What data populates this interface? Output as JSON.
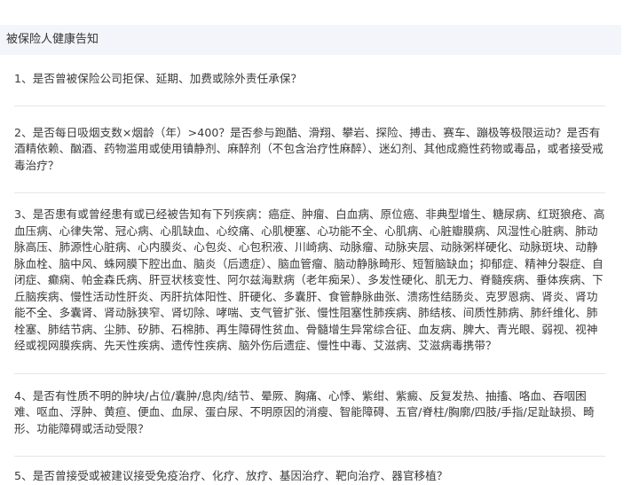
{
  "header": {
    "title": "被保险人健康告知"
  },
  "questions": [
    {
      "text": "1、是否曾被保险公司拒保、延期、加费或除外责任承保？"
    },
    {
      "text": "2、是否每日吸烟支数×烟龄（年）>400？是否参与跑酷、滑翔、攀岩、探险、搏击、赛车、蹦极等极限运动？是否有酒精依赖、酗酒、药物滥用或使用镇静剂、麻醉剂（不包含治疗性麻醉）、迷幻剂、其他成瘾性药物或毒品，或者接受戒毒治疗？"
    },
    {
      "text": "3、是否患有或曾经患有或已经被告知有下列疾病：癌症、肿瘤、白血病、原位癌、非典型增生、糖尿病、红斑狼疮、高血压病、心律失常、冠心病、心肌缺血、心绞痛、心肌梗塞、心功能不全、心肌病、心脏瓣膜病、风湿性心脏病、肺动脉高压、肺源性心脏病、心内膜炎、心包炎、心包积液、川崎病、动脉瘤、动脉夹层、动脉粥样硬化、动脉斑块、动静脉血栓、脑中风、蛛网膜下腔出血、脑炎（后遗症）、脑血管瘤、脑动静脉畸形、短暂脑缺血；抑郁症、精神分裂症、自闭症、癫痫、帕金森氏病、肝豆状核变性、阿尔兹海默病（老年痴呆）、多发性硬化、肌无力、脊髓疾病、垂体疾病、下丘脑疾病、慢性活动性肝炎、丙肝抗体阳性、肝硬化、多囊肝、食管静脉曲张、溃疡性结肠炎、克罗恩病、肾炎、肾功能不全、多囊肾、肾动脉狭窄、肾切除、哮喘、支气管扩张、慢性阻塞性肺疾病、肺结核、间质性肺病、肺纤维化、肺栓塞、肺结节病、尘肺、矽肺、石棉肺、再生障碍性贫血、骨髓增生异常综合征、血友病、脾大、青光眼、弱视、视神经或视网膜疾病、先天性疾病、遗传性疾病、脑外伤后遗症、慢性中毒、艾滋病、艾滋病毒携带？"
    },
    {
      "text": "4、是否有性质不明的肿块/占位/囊肿/息肉/结节、晕厥、胸痛、心悸、紫绀、紫癜、反复发热、抽搐、咯血、吞咽困难、呕血、浮肿、黄疸、便血、血尿、蛋白尿、不明原因的消瘦、智能障碍、五官/脊柱/胸廓/四肢/手指/足趾缺损、畸形、功能障碍或活动受限？"
    },
    {
      "text": "5、是否曾接受或被建议接受免疫治疗、化疗、放疗、基因治疗、靶向治疗、器官移植？"
    }
  ]
}
